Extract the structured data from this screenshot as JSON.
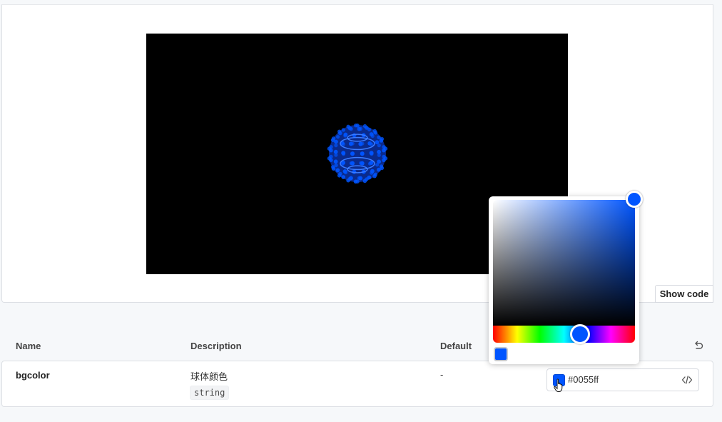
{
  "preview": {
    "show_code_label": "Show code",
    "canvas_background": "#000000",
    "sphere_color": "#0055ff"
  },
  "table": {
    "headers": {
      "name": "Name",
      "description": "Description",
      "default": "Default"
    },
    "rows": [
      {
        "name": "bgcolor",
        "description": "球体颜色",
        "type": "string",
        "default": "-",
        "control_value": "#0055ff"
      }
    ]
  },
  "color_picker": {
    "hue_color": "#0055ff",
    "selected_color": "#0055ff",
    "preset_color": "#0055ff"
  },
  "icons": {
    "reset": "undo-icon",
    "code": "code-icon",
    "cursor": "pointer-cursor-icon"
  }
}
